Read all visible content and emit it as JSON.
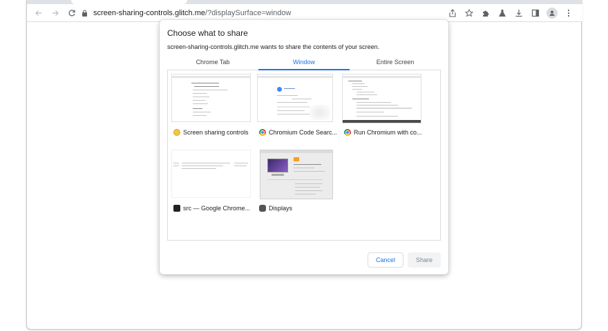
{
  "browser": {
    "url_host": "screen-sharing-controls.glitch.me",
    "url_path": "/?displaySurface=window"
  },
  "dialog": {
    "title": "Choose what to share",
    "description": "screen-sharing-controls.glitch.me wants to share the contents of your screen.",
    "tabs": [
      {
        "label": "Chrome Tab"
      },
      {
        "label": "Window"
      },
      {
        "label": "Entire Screen"
      }
    ],
    "active_tab": "Window",
    "sources": [
      {
        "label": "Screen sharing controls",
        "icon": "glitch-fish-icon"
      },
      {
        "label": "Chromium Code Searc...",
        "icon": "chromium-icon"
      },
      {
        "label": "Run Chromium with co...",
        "icon": "chromium-icon"
      },
      {
        "label": "src — Google Chrome...",
        "icon": "terminal-icon"
      },
      {
        "label": "Displays",
        "icon": "system-preferences-icon"
      }
    ],
    "cancel_label": "Cancel",
    "share_label": "Share"
  },
  "colors": {
    "accent": "#1a73e8",
    "border": "#dadce0"
  }
}
